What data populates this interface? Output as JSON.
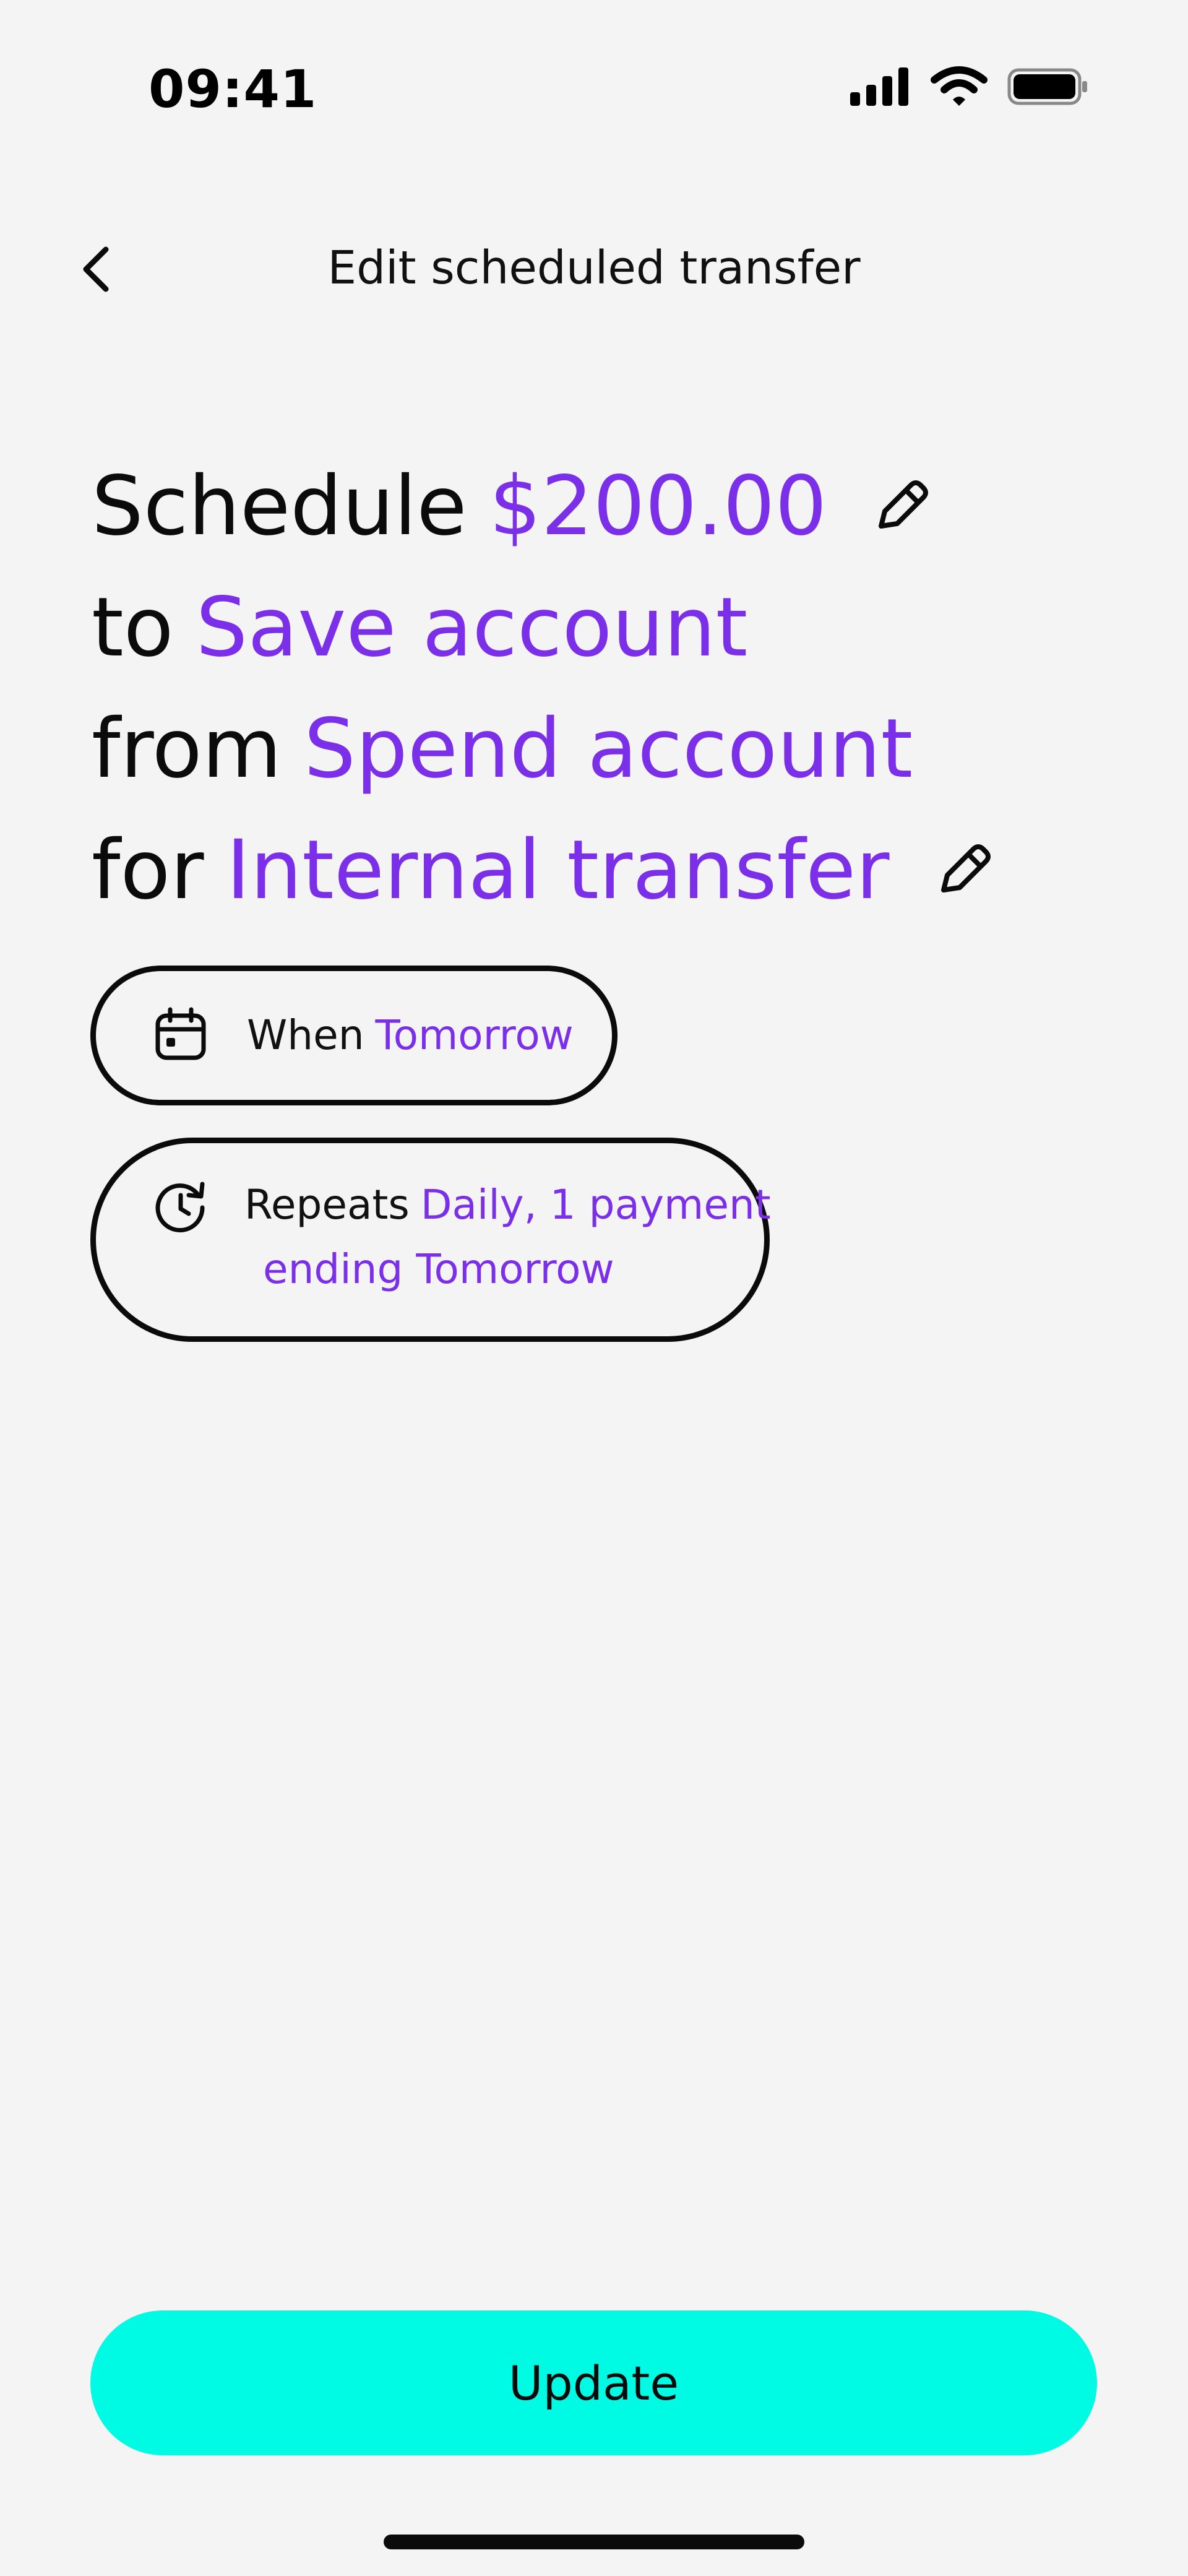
{
  "status_bar": {
    "time": "09:41",
    "icons": [
      "signal-icon",
      "wifi-icon",
      "battery-icon"
    ]
  },
  "nav": {
    "back_icon": "chevron-left-icon",
    "title": "Edit scheduled transfer"
  },
  "summary": {
    "line1": {
      "lead": "Schedule",
      "value": "$200.00"
    },
    "line2": {
      "lead": "to",
      "value": "Save account"
    },
    "line3": {
      "lead": "from",
      "value": "Spend account"
    },
    "line4": {
      "lead": "for",
      "value": "Internal transfer"
    }
  },
  "when": {
    "icon": "calendar-icon",
    "label": "When",
    "value": "Tomorrow"
  },
  "repeats": {
    "icon": "repeat-clock-icon",
    "label": "Repeats",
    "value_line1": "Daily, 1 payment",
    "value_line2": "ending Tomorrow"
  },
  "update_button": {
    "label": "Update"
  },
  "colors": {
    "accent": "#7b2fe8",
    "primary_button": "#00fbe4",
    "background": "#f4f4f4",
    "text": "#0b0b0b"
  }
}
